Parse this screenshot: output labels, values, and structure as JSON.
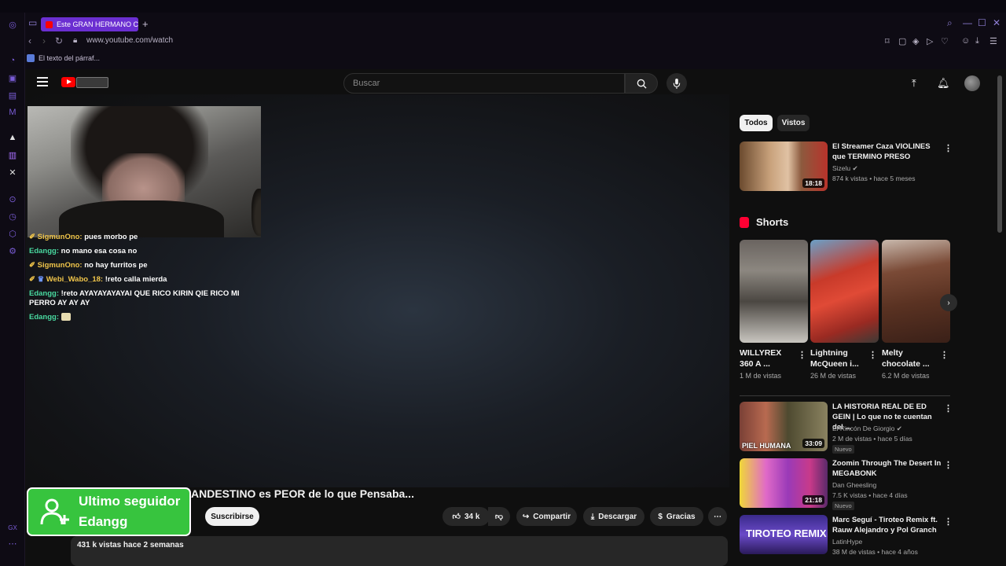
{
  "browser": {
    "tab_title": "Este GRAN HERMANO CL",
    "url": "www.youtube.com/watch",
    "bookmark": "El texto del párraf..."
  },
  "header": {
    "search_placeholder": "Buscar"
  },
  "chat": [
    {
      "user": "SigmunOno:",
      "text": "pues morbo pe",
      "color": "gold"
    },
    {
      "user": "Edangg:",
      "text": "no mano esa cosa no",
      "color": "green"
    },
    {
      "user": "SigmunOno:",
      "text": "no hay furritos pe",
      "color": "gold"
    },
    {
      "user": "Webi_Wabo_18:",
      "text": "!reto calla mierda",
      "color": "gold"
    },
    {
      "user": "Edangg:",
      "text": "!reto AYAYAYAYAYAI QUE RICO KIRIN QIE RICO MI PERRO AY AY AY",
      "color": "green"
    },
    {
      "user": "Edangg:",
      "text": "",
      "color": "green"
    }
  ],
  "follower": {
    "line1": "Ultimo seguidor",
    "line2": "Edangg"
  },
  "video": {
    "title_fragment": "ANDESTINO es PEOR de lo que Pensaba...",
    "subscribe": "Suscribirse",
    "likes": "34 k",
    "share": "Compartir",
    "download": "Descargar",
    "thanks": "Gracias",
    "views_date": "431 k vistas  hace 2 semanas"
  },
  "chips": [
    "Todos",
    "Vistos"
  ],
  "recommendations": [
    {
      "title": "El Streamer Caza VIOLINES que TERMINO PRESO",
      "channel": "Sizelu",
      "meta": "874 k vistas • hace 5 meses",
      "duration": "18:18",
      "new": ""
    },
    {
      "title": "LA HISTORIA REAL DE ED GEIN | Lo que no te cuentan del ...",
      "channel": "El Rincón De Giorgio",
      "meta": "2 M de vistas • hace 5 días",
      "duration": "33:09",
      "new": "Nuevo",
      "thumb_text": "PIEL HUMANA"
    },
    {
      "title": "Zoomin Through The Desert In MEGABONK",
      "channel": "Dan Gheesling",
      "meta": "7.5 K vistas • hace 4 días",
      "duration": "21:18",
      "new": "Nuevo"
    },
    {
      "title": "Marc Seguí - Tiroteo Remix ft. Rauw Alejandro y Pol Granch",
      "channel": "LatinHype",
      "meta": "38 M de vistas • hace 4 años",
      "duration": "",
      "new": "",
      "thumb_text": "TIROTEO REMIX"
    }
  ],
  "shorts": {
    "heading": "Shorts",
    "items": [
      {
        "title": "WILLYREX 360 A ...",
        "views": "1 M de vistas"
      },
      {
        "title": "Lightning McQueen i...",
        "views": "26 M de vistas"
      },
      {
        "title": "Melty chocolate ...",
        "views": "6.2 M de vistas"
      }
    ]
  },
  "colors": {
    "accent_browser": "#6b2fd1",
    "follower_bg": "#37c43e",
    "yt_red": "#ff0000"
  }
}
